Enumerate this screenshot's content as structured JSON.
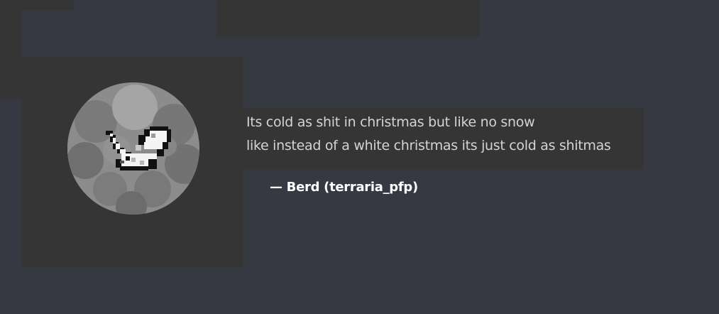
{
  "quote": {
    "lines": [
      "Its cold as shit in christmas but like no snow",
      "like instead of a white christmas its just cold as shitmas"
    ],
    "dash": "—",
    "author_display_name": "Berd",
    "author_username": "terraria_pfp"
  },
  "avatar": {
    "icon": "pixel-bird-avatar"
  },
  "colors": {
    "background": "#363941",
    "panel": "#353535",
    "quote_text": "#d4d4d4",
    "attribution_text": "#ffffff"
  }
}
